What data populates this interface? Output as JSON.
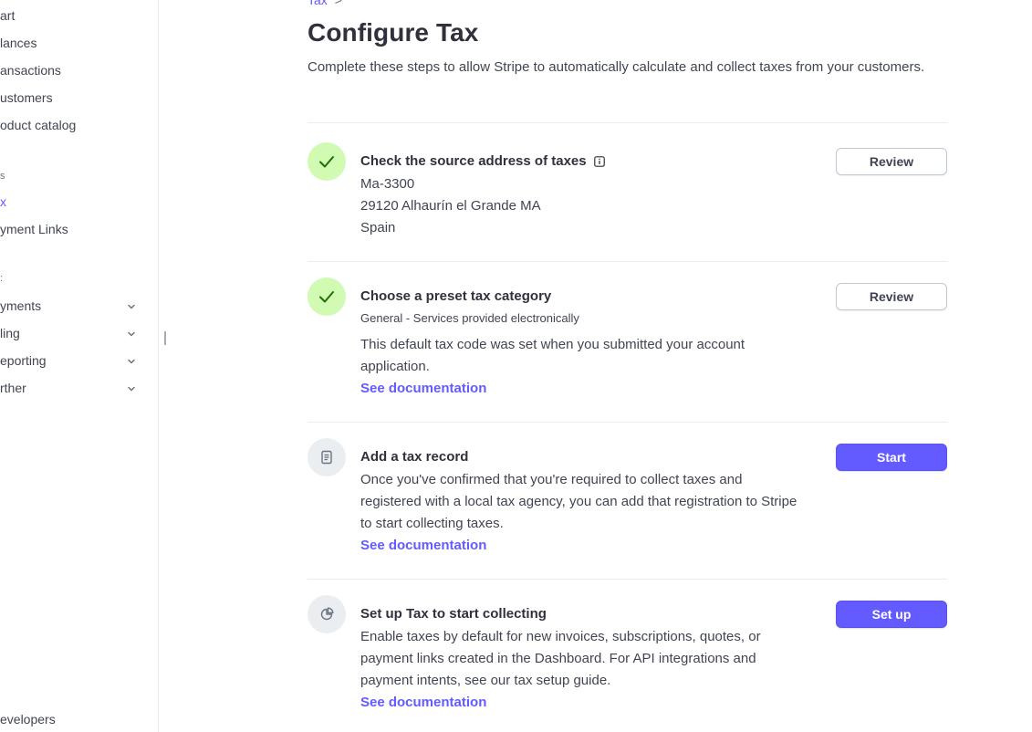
{
  "sidebar": {
    "items": [
      {
        "label": "art"
      },
      {
        "label": "lances"
      },
      {
        "label": "ansactions"
      },
      {
        "label": "ustomers"
      },
      {
        "label": "oduct catalog"
      }
    ],
    "section_shortcuts": "s",
    "shortcut_items": [
      {
        "label": "x",
        "active": true
      },
      {
        "label": "yment Links"
      }
    ],
    "section_products": ":",
    "product_items": [
      {
        "label": "yments"
      },
      {
        "label": "ling"
      },
      {
        "label": "eporting"
      },
      {
        "label": "rther"
      }
    ],
    "footer_item": "evelopers"
  },
  "breadcrumb": {
    "label": "Tax",
    "separator": ">"
  },
  "page": {
    "title": "Configure Tax",
    "description": "Complete these steps to allow Stripe to automatically calculate and collect taxes from your customers."
  },
  "steps": [
    {
      "title": "Check the source address of taxes",
      "status": "complete",
      "address_line1": "Ma-3300",
      "address_line2": "29120 Alhaurín el Grande MA",
      "address_line3": "Spain",
      "button": "Review"
    },
    {
      "title": "Choose a preset tax category",
      "status": "complete",
      "subtitle": "General - Services provided electronically",
      "description": "This default tax code was set when you submitted your account application.",
      "link": "See documentation",
      "button": "Review"
    },
    {
      "title": "Add a tax record",
      "status": "pending",
      "icon": "document-icon",
      "description": "Once you've confirmed that you're required to collect taxes and registered with a local tax agency, you can add that registration to Stripe to start collecting taxes.",
      "link": "See documentation",
      "button": "Start"
    },
    {
      "title": "Set up Tax to start collecting",
      "status": "pending",
      "icon": "pie-chart-icon",
      "description": "Enable taxes by default for new invoices, subscriptions, quotes, or payment links created in the Dashboard. For API integrations and payment intents, see our tax setup guide.",
      "link": "See documentation",
      "button": "Set up"
    }
  ],
  "colors": {
    "accent": "#635bff",
    "success_bg": "#d1fab3",
    "success_check": "#217005",
    "pending_bg": "#ebeef1"
  }
}
